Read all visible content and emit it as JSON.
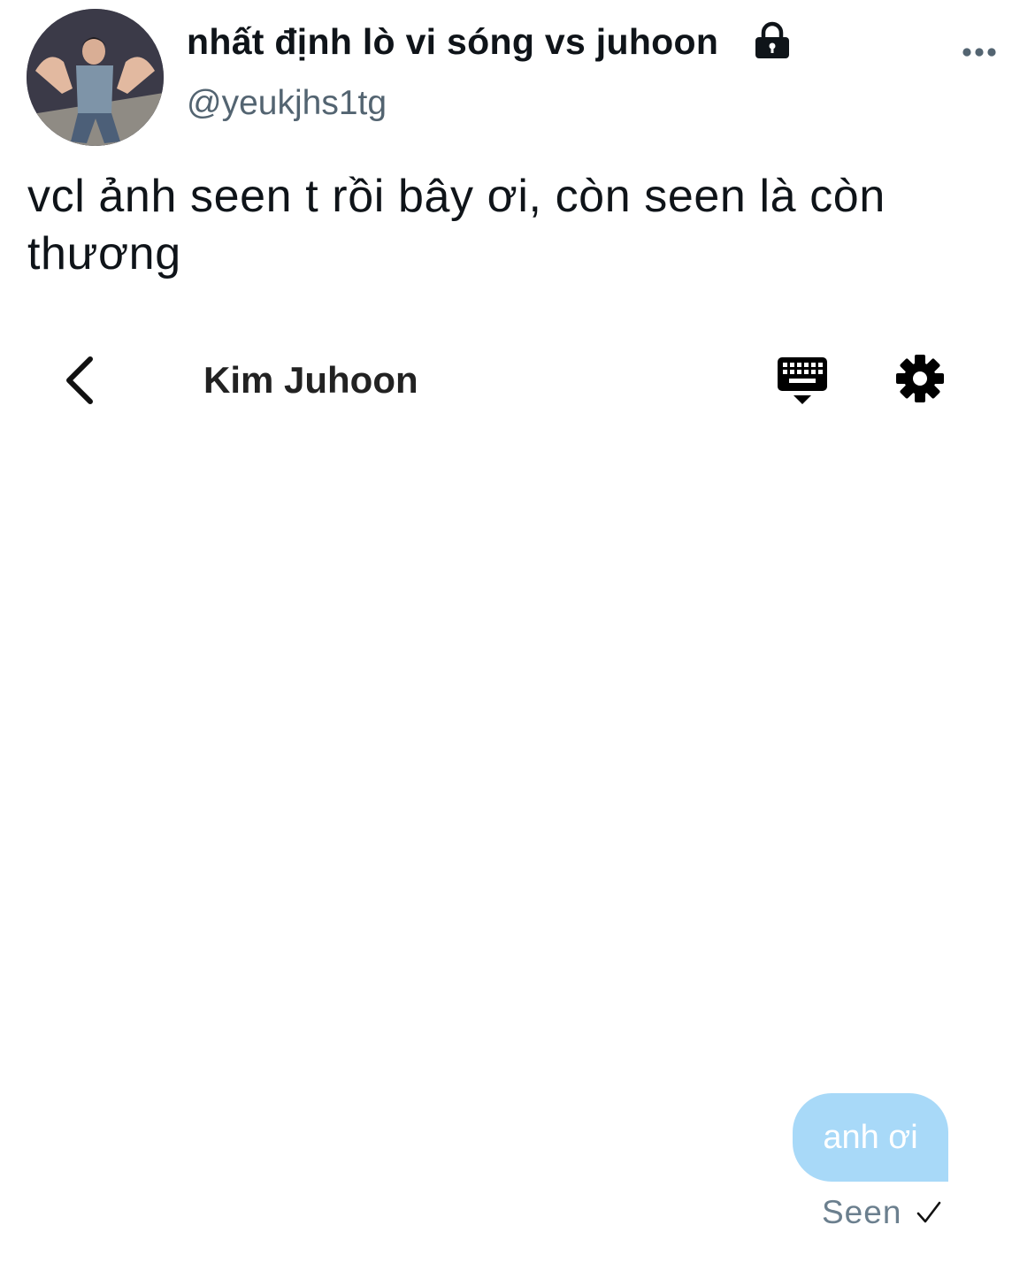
{
  "tweet": {
    "display_name": "nhất định lò vi sóng vs juhoon",
    "handle": "@yeukjhs1tg",
    "protected_icon": "lock-icon",
    "more_icon": "more-horizontal-icon",
    "text": "vcl ảnh seen t rồi bây ơi, còn seen là còn thương"
  },
  "dm": {
    "back_icon": "chevron-left-icon",
    "contact_name": "Kim Juhoon",
    "keyboard_icon": "keyboard-icon",
    "settings_icon": "gear-icon",
    "messages": [
      {
        "text": "anh ơi",
        "sender": "me"
      }
    ],
    "seen_label": "Seen",
    "seen_icon": "check-icon"
  },
  "colors": {
    "text_primary": "#0f1419",
    "text_secondary": "#536471",
    "bubble": "#a8d9f8",
    "seen": "#6b7f8e"
  }
}
